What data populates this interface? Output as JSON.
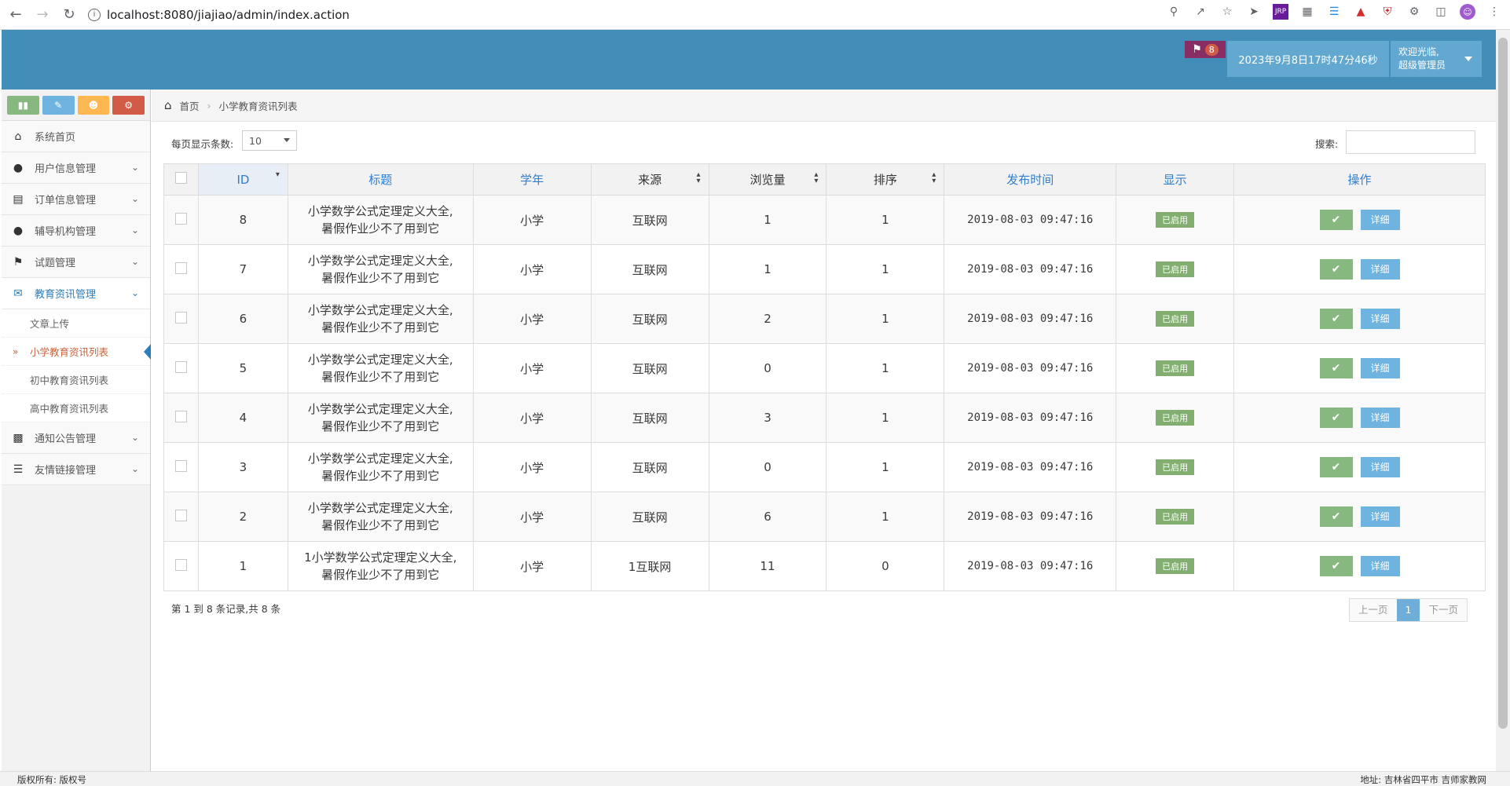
{
  "browser": {
    "url": "localhost:8080/jiajiao/admin/index.action"
  },
  "header": {
    "notification_count": "8",
    "datetime": "2023年9月8日17时47分46秒",
    "welcome": "欢迎光临,",
    "role": "超级管理员"
  },
  "sidebar": {
    "items": [
      {
        "label": "系统首页",
        "icon": "home-icon"
      },
      {
        "label": "用户信息管理",
        "icon": "user-icon"
      },
      {
        "label": "订单信息管理",
        "icon": "credit-card-icon"
      },
      {
        "label": "辅导机构管理",
        "icon": "user-icon"
      },
      {
        "label": "试题管理",
        "icon": "bookmark-icon"
      },
      {
        "label": "教育资讯管理",
        "icon": "comments-icon"
      },
      {
        "label": "通知公告管理",
        "icon": "desktop-icon"
      },
      {
        "label": "友情链接管理",
        "icon": "list-icon"
      }
    ],
    "subitems": [
      {
        "label": "文章上传"
      },
      {
        "label": "小学教育资讯列表"
      },
      {
        "label": "初中教育资讯列表"
      },
      {
        "label": "高中教育资讯列表"
      }
    ],
    "shortcut_colors": [
      "#87b87f",
      "#6fb3e0",
      "#ffb752",
      "#d15b47"
    ]
  },
  "breadcrumb": {
    "home": "首页",
    "current": "小学教育资讯列表"
  },
  "controls": {
    "pagesize_label": "每页显示条数:",
    "pagesize_value": "10",
    "search_label": "搜索:"
  },
  "table": {
    "headers": {
      "id": "ID",
      "title": "标题",
      "year": "学年",
      "source": "来源",
      "views": "浏览量",
      "order": "排序",
      "time": "发布时间",
      "display": "显示",
      "action": "操作"
    },
    "rows": [
      {
        "id": "8",
        "title1": "小学数学公式定理定义大全,",
        "title2": "暑假作业少不了用到它",
        "year": "小学",
        "source": "互联网",
        "views": "1",
        "order": "1",
        "time": "2019-08-03 09:47:16",
        "status": "已启用",
        "detail": "详细"
      },
      {
        "id": "7",
        "title1": "小学数学公式定理定义大全,",
        "title2": "暑假作业少不了用到它",
        "year": "小学",
        "source": "互联网",
        "views": "1",
        "order": "1",
        "time": "2019-08-03 09:47:16",
        "status": "已启用",
        "detail": "详细"
      },
      {
        "id": "6",
        "title1": "小学数学公式定理定义大全,",
        "title2": "暑假作业少不了用到它",
        "year": "小学",
        "source": "互联网",
        "views": "2",
        "order": "1",
        "time": "2019-08-03 09:47:16",
        "status": "已启用",
        "detail": "详细"
      },
      {
        "id": "5",
        "title1": "小学数学公式定理定义大全,",
        "title2": "暑假作业少不了用到它",
        "year": "小学",
        "source": "互联网",
        "views": "0",
        "order": "1",
        "time": "2019-08-03 09:47:16",
        "status": "已启用",
        "detail": "详细"
      },
      {
        "id": "4",
        "title1": "小学数学公式定理定义大全,",
        "title2": "暑假作业少不了用到它",
        "year": "小学",
        "source": "互联网",
        "views": "3",
        "order": "1",
        "time": "2019-08-03 09:47:16",
        "status": "已启用",
        "detail": "详细"
      },
      {
        "id": "3",
        "title1": "小学数学公式定理定义大全,",
        "title2": "暑假作业少不了用到它",
        "year": "小学",
        "source": "互联网",
        "views": "0",
        "order": "1",
        "time": "2019-08-03 09:47:16",
        "status": "已启用",
        "detail": "详细"
      },
      {
        "id": "2",
        "title1": "小学数学公式定理定义大全,",
        "title2": "暑假作业少不了用到它",
        "year": "小学",
        "source": "互联网",
        "views": "6",
        "order": "1",
        "time": "2019-08-03 09:47:16",
        "status": "已启用",
        "detail": "详细"
      },
      {
        "id": "1",
        "title1": "1小学数学公式定理定义大全,",
        "title2": "暑假作业少不了用到它",
        "year": "小学",
        "source": "1互联网",
        "views": "11",
        "order": "0",
        "time": "2019-08-03 09:47:16",
        "status": "已启用",
        "detail": "详细"
      }
    ]
  },
  "footer": {
    "records_info": "第 1 到 8 条记录,共 8 条",
    "prev": "上一页",
    "current_page": "1",
    "next": "下一页",
    "copyright": "版权所有: 版权号",
    "address": "地址: 吉林省四平市  吉师家教网"
  }
}
